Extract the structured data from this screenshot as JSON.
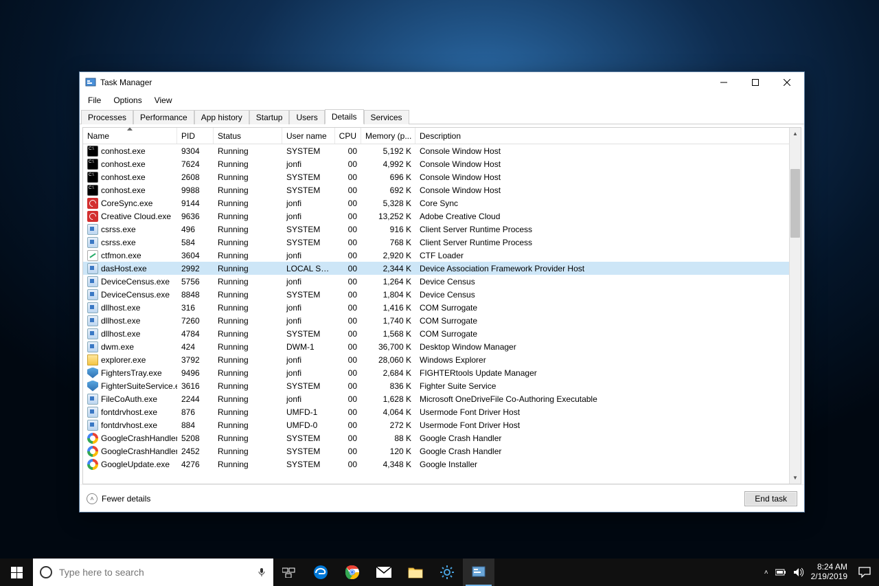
{
  "window": {
    "title": "Task Manager",
    "minimize_tooltip": "Minimize",
    "maximize_tooltip": "Maximize",
    "close_tooltip": "Close"
  },
  "menu": {
    "file": "File",
    "options": "Options",
    "view": "View"
  },
  "tabs": {
    "processes": "Processes",
    "performance": "Performance",
    "app_history": "App history",
    "startup": "Startup",
    "users": "Users",
    "details": "Details",
    "services": "Services"
  },
  "columns": {
    "name": "Name",
    "pid": "PID",
    "status": "Status",
    "user": "User name",
    "cpu": "CPU",
    "mem": "Memory (p...",
    "desc": "Description"
  },
  "rows": [
    {
      "icon": "console",
      "name": "conhost.exe",
      "pid": "9304",
      "status": "Running",
      "user": "SYSTEM",
      "cpu": "00",
      "mem": "5,192 K",
      "desc": "Console Window Host"
    },
    {
      "icon": "console",
      "name": "conhost.exe",
      "pid": "7624",
      "status": "Running",
      "user": "jonfi",
      "cpu": "00",
      "mem": "4,992 K",
      "desc": "Console Window Host"
    },
    {
      "icon": "console",
      "name": "conhost.exe",
      "pid": "2608",
      "status": "Running",
      "user": "SYSTEM",
      "cpu": "00",
      "mem": "696 K",
      "desc": "Console Window Host"
    },
    {
      "icon": "console",
      "name": "conhost.exe",
      "pid": "9988",
      "status": "Running",
      "user": "SYSTEM",
      "cpu": "00",
      "mem": "692 K",
      "desc": "Console Window Host"
    },
    {
      "icon": "cc-red",
      "name": "CoreSync.exe",
      "pid": "9144",
      "status": "Running",
      "user": "jonfi",
      "cpu": "00",
      "mem": "5,328 K",
      "desc": "Core Sync"
    },
    {
      "icon": "cc-red",
      "name": "Creative Cloud.exe",
      "pid": "9636",
      "status": "Running",
      "user": "jonfi",
      "cpu": "00",
      "mem": "13,252 K",
      "desc": "Adobe Creative Cloud"
    },
    {
      "icon": "generic",
      "name": "csrss.exe",
      "pid": "496",
      "status": "Running",
      "user": "SYSTEM",
      "cpu": "00",
      "mem": "916 K",
      "desc": "Client Server Runtime Process"
    },
    {
      "icon": "generic",
      "name": "csrss.exe",
      "pid": "584",
      "status": "Running",
      "user": "SYSTEM",
      "cpu": "00",
      "mem": "768 K",
      "desc": "Client Server Runtime Process"
    },
    {
      "icon": "pen",
      "name": "ctfmon.exe",
      "pid": "3604",
      "status": "Running",
      "user": "jonfi",
      "cpu": "00",
      "mem": "2,920 K",
      "desc": "CTF Loader"
    },
    {
      "icon": "generic",
      "name": "dasHost.exe",
      "pid": "2992",
      "status": "Running",
      "user": "LOCAL SE...",
      "cpu": "00",
      "mem": "2,344 K",
      "desc": "Device Association Framework Provider Host",
      "selected": true
    },
    {
      "icon": "generic",
      "name": "DeviceCensus.exe",
      "pid": "5756",
      "status": "Running",
      "user": "jonfi",
      "cpu": "00",
      "mem": "1,264 K",
      "desc": "Device Census"
    },
    {
      "icon": "generic",
      "name": "DeviceCensus.exe",
      "pid": "8848",
      "status": "Running",
      "user": "SYSTEM",
      "cpu": "00",
      "mem": "1,804 K",
      "desc": "Device Census"
    },
    {
      "icon": "generic",
      "name": "dllhost.exe",
      "pid": "316",
      "status": "Running",
      "user": "jonfi",
      "cpu": "00",
      "mem": "1,416 K",
      "desc": "COM Surrogate"
    },
    {
      "icon": "generic",
      "name": "dllhost.exe",
      "pid": "7260",
      "status": "Running",
      "user": "jonfi",
      "cpu": "00",
      "mem": "1,740 K",
      "desc": "COM Surrogate"
    },
    {
      "icon": "generic",
      "name": "dllhost.exe",
      "pid": "4784",
      "status": "Running",
      "user": "SYSTEM",
      "cpu": "00",
      "mem": "1,568 K",
      "desc": "COM Surrogate"
    },
    {
      "icon": "generic",
      "name": "dwm.exe",
      "pid": "424",
      "status": "Running",
      "user": "DWM-1",
      "cpu": "00",
      "mem": "36,700 K",
      "desc": "Desktop Window Manager"
    },
    {
      "icon": "folder",
      "name": "explorer.exe",
      "pid": "3792",
      "status": "Running",
      "user": "jonfi",
      "cpu": "00",
      "mem": "28,060 K",
      "desc": "Windows Explorer"
    },
    {
      "icon": "shield",
      "name": "FightersTray.exe",
      "pid": "9496",
      "status": "Running",
      "user": "jonfi",
      "cpu": "00",
      "mem": "2,684 K",
      "desc": "FIGHTERtools Update Manager"
    },
    {
      "icon": "shield",
      "name": "FighterSuiteService.e...",
      "pid": "3616",
      "status": "Running",
      "user": "SYSTEM",
      "cpu": "00",
      "mem": "836 K",
      "desc": "Fighter Suite Service"
    },
    {
      "icon": "generic",
      "name": "FileCoAuth.exe",
      "pid": "2244",
      "status": "Running",
      "user": "jonfi",
      "cpu": "00",
      "mem": "1,628 K",
      "desc": "Microsoft OneDriveFile Co-Authoring Executable"
    },
    {
      "icon": "generic",
      "name": "fontdrvhost.exe",
      "pid": "876",
      "status": "Running",
      "user": "UMFD-1",
      "cpu": "00",
      "mem": "4,064 K",
      "desc": "Usermode Font Driver Host"
    },
    {
      "icon": "generic",
      "name": "fontdrvhost.exe",
      "pid": "884",
      "status": "Running",
      "user": "UMFD-0",
      "cpu": "00",
      "mem": "272 K",
      "desc": "Usermode Font Driver Host"
    },
    {
      "icon": "google",
      "name": "GoogleCrashHandler...",
      "pid": "5208",
      "status": "Running",
      "user": "SYSTEM",
      "cpu": "00",
      "mem": "88 K",
      "desc": "Google Crash Handler"
    },
    {
      "icon": "google",
      "name": "GoogleCrashHandler...",
      "pid": "2452",
      "status": "Running",
      "user": "SYSTEM",
      "cpu": "00",
      "mem": "120 K",
      "desc": "Google Crash Handler"
    },
    {
      "icon": "google",
      "name": "GoogleUpdate.exe",
      "pid": "4276",
      "status": "Running",
      "user": "SYSTEM",
      "cpu": "00",
      "mem": "4,348 K",
      "desc": "Google Installer"
    }
  ],
  "footer": {
    "fewer": "Fewer details",
    "end_task": "End task"
  },
  "taskbar": {
    "search_placeholder": "Type here to search",
    "time": "8:24 AM",
    "date": "2/19/2019"
  }
}
